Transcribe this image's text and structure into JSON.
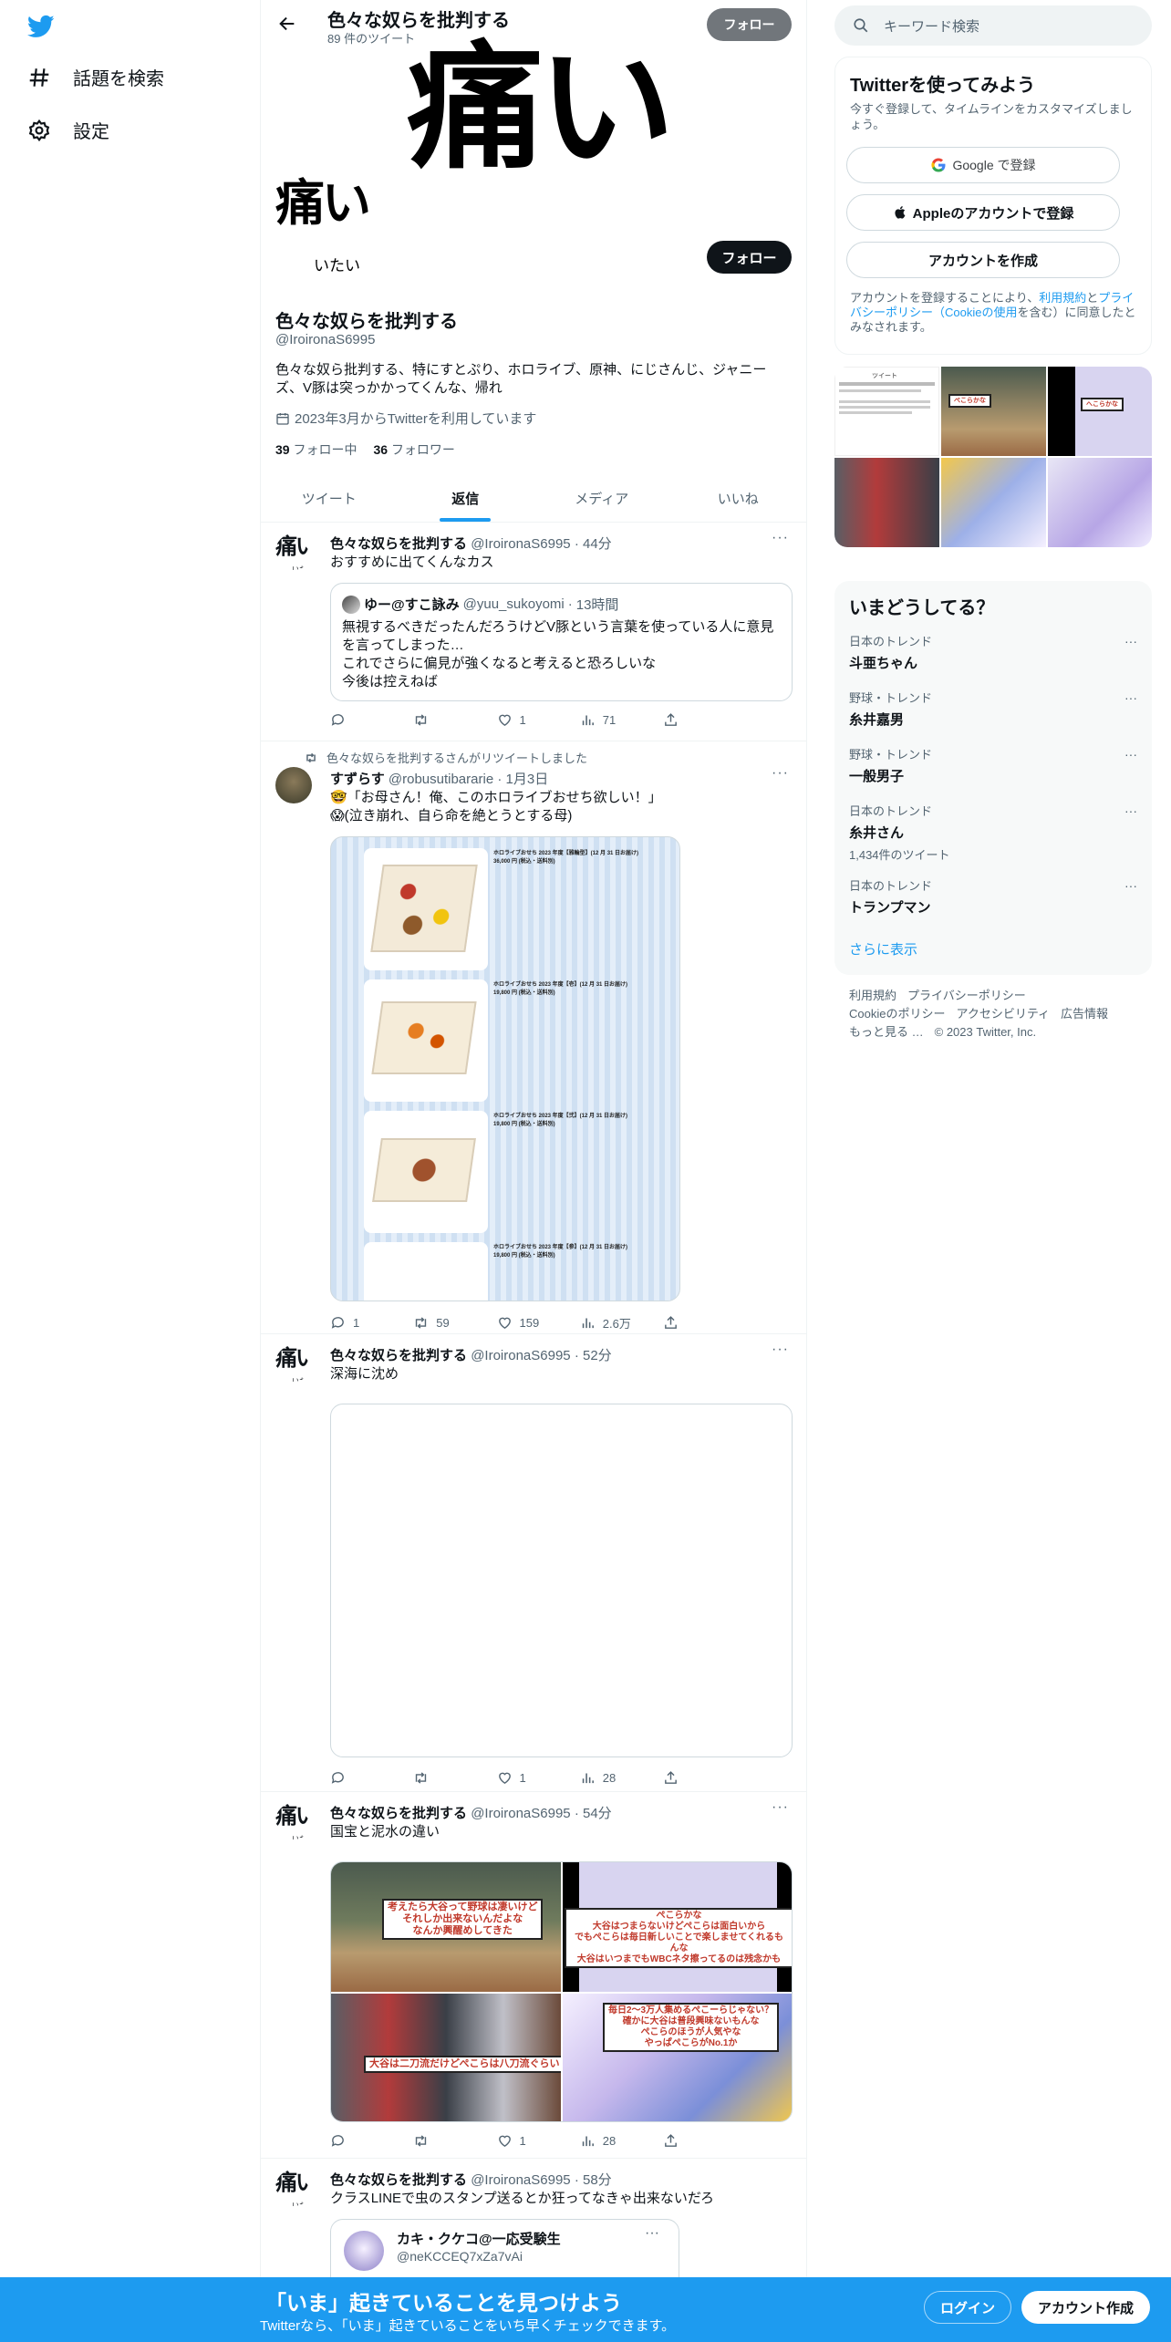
{
  "sidebar": {
    "explore_label": "話題を検索",
    "settings_label": "設定"
  },
  "topbar": {
    "name": "色々な奴らを批判する",
    "tweet_count": "89 件のツイート",
    "follow_label": "フォロー"
  },
  "banner": {
    "text": "痛い"
  },
  "avatar": {
    "text": "痛い",
    "ruby": "いたい"
  },
  "profile": {
    "follow_label": "フォロー",
    "name": "色々な奴らを批判する",
    "handle": "@IroironaS6995",
    "bio": "色々な奴ら批判する、特にすとぷり、ホロライブ、原神、にじさんじ、ジャニーズ、V豚は突っかかってくんな、帰れ",
    "joined": "2023年3月からTwitterを利用しています",
    "following_count": "39",
    "following_label": "フォロー中",
    "followers_count": "36",
    "followers_label": "フォロワー"
  },
  "tabs": [
    "ツイート",
    "返信",
    "メディア",
    "いいね"
  ],
  "tweets": [
    {
      "name": "色々な奴らを批判する",
      "handle": "@IroironaS6995",
      "time": "44分",
      "text": "おすすめに出てくんなカス",
      "quote": {
        "name": "ゆー@すこ詠み",
        "handle": "@yuu_sukoyomi",
        "time": "13時間",
        "text": "無視するべきだったんだろうけどV豚という言葉を使っている人に意見を言ってしまった…\nこれでさらに偏見が強くなると考えると恐ろしいな\n今後は控えねば"
      },
      "likes": "1",
      "views": "71"
    },
    {
      "retweet_note": "色々な奴らを批判するさんがリツイートしました",
      "name": "すずらす",
      "handle": "@robusutibararie",
      "time": "1月3日",
      "text": "🤓「お母さん！俺、このホロライブおせち欲しい！」\n😱(泣き崩れ、自ら命を絶とうとする母)",
      "replies": "1",
      "retweets": "59",
      "likes": "159",
      "views": "2.6万",
      "osechi_items": [
        {
          "title": "ホロライブおせち 2023 年度【雅輪型】(12 月 31 日お届け)",
          "price": "36,000 円 (税込・送料別)"
        },
        {
          "title": "ホロライブおせち 2023 年度【壱】(12 月 31 日お届け)",
          "price": "19,800 円 (税込・送料別)"
        },
        {
          "title": "ホロライブおせち 2023 年度【弐】(12 月 31 日お届け)",
          "price": "19,800 円 (税込・送料別)"
        },
        {
          "title": "ホロライブおせち 2023 年度【参】(12 月 31 日お届け)",
          "price": "19,800 円 (税込・送料別)"
        }
      ]
    },
    {
      "name": "色々な奴らを批判する",
      "handle": "@IroironaS6995",
      "time": "52分",
      "text": "深海に沈め",
      "likes": "1",
      "views": "28"
    },
    {
      "name": "色々な奴らを批判する",
      "handle": "@IroironaS6995",
      "time": "54分",
      "text": "国宝と泥水の違い",
      "captions": [
        "考えたら大谷って野球は凄いけど\nそれしか出来ないんだよな\nなんか興醒めしてきた",
        "ぺこらかな\n大谷はつまらないけどぺこらは面白いから\nでもぺこらは毎日新しいことで楽しませてくれるもんな\n大谷はいつまでもWBCネタ擦ってるのは残念かも",
        "大谷は二刀流だけどぺこらは八刀流ぐらい",
        "毎日2～3万人集めるぺこーらじゃない？\n確かに大谷は普段興味ないもんな\nぺこらのほうが人気やな\nやっぱぺこらがNo.1か"
      ],
      "likes": "1",
      "views": "28"
    },
    {
      "name": "色々な奴らを批判する",
      "handle": "@IroironaS6995",
      "time": "58分",
      "text": "クラスLINEで虫のスタンプ送るとか狂ってなきゃ出来ないだろ",
      "quote": {
        "name": "カキ・クケコ@一応受験生",
        "handle": "@neKCCEQ7xZa7vAi"
      }
    }
  ],
  "right": {
    "search_placeholder": "キーワード検索",
    "signup_title": "Twitterを使ってみよう",
    "signup_sub": "今すぐ登録して、タイムラインをカスタマイズしましょう。",
    "google_label": "Google で登録",
    "apple_label": "Appleのアカウントで登録",
    "create_label": "アカウントを作成",
    "legal_pre": "アカウントを登録することにより、",
    "legal_terms": "利用規約",
    "legal_and": "と",
    "legal_privacy": "プライバシーポリシー（Cookieの使用",
    "legal_post": "を含む）に同意したとみなされます。",
    "media_captions": [
      "ツイート",
      "ぺこらかな",
      "へこらかな"
    ],
    "trends_title": "いまどうしてる？",
    "trends": [
      {
        "context": "日本のトレンド",
        "name": "斗亜ちゃん",
        "count": ""
      },
      {
        "context": "野球・トレンド",
        "name": "糸井嘉男",
        "count": ""
      },
      {
        "context": "野球・トレンド",
        "name": "一般男子",
        "count": ""
      },
      {
        "context": "日本のトレンド",
        "name": "糸井さん",
        "count": "1,434件のツイート"
      },
      {
        "context": "日本のトレンド",
        "name": "トランプマン",
        "count": ""
      }
    ],
    "show_more": "さらに表示",
    "footer": [
      "利用規約",
      "プライバシーポリシー",
      "Cookieのポリシー",
      "アクセシビリティ",
      "広告情報",
      "もっと見る …",
      "© 2023 Twitter, Inc."
    ]
  },
  "bottombar": {
    "title": "「いま」起きていることを見つけよう",
    "subtitle": "Twitterなら、「いま」起きていることをいち早くチェックできます。",
    "login_label": "ログイン",
    "create_label": "アカウント作成"
  }
}
